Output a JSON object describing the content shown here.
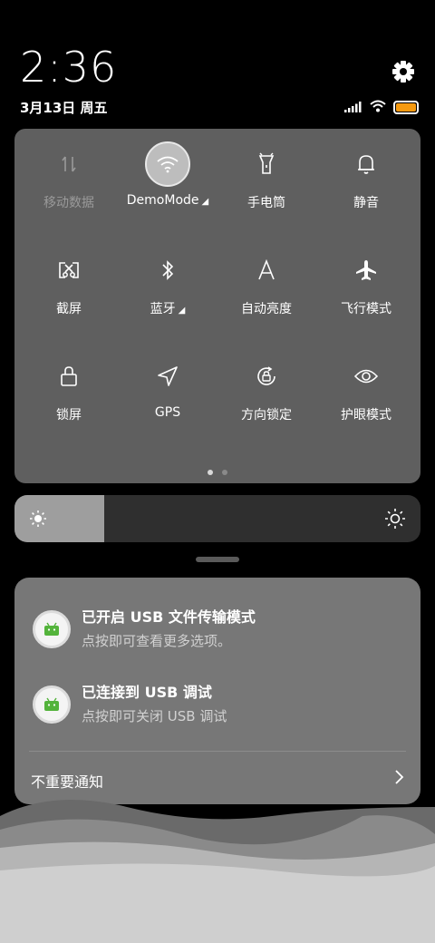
{
  "status_bar": {
    "time": "2:36",
    "date": "3月13日 周五",
    "battery_color": "#f59a10"
  },
  "quick_settings": {
    "tiles": [
      {
        "label": "移动数据",
        "icon": "mobile-data-icon",
        "state": "disabled"
      },
      {
        "label": "DemoMode",
        "icon": "wifi-icon",
        "state": "active",
        "expand": "◢"
      },
      {
        "label": "手电筒",
        "icon": "flashlight-icon",
        "state": "off"
      },
      {
        "label": "静音",
        "icon": "bell-icon",
        "state": "off"
      },
      {
        "label": "截屏",
        "icon": "screenshot-icon",
        "state": "off"
      },
      {
        "label": "蓝牙",
        "icon": "bluetooth-icon",
        "state": "off",
        "expand": "◢"
      },
      {
        "label": "自动亮度",
        "icon": "auto-brightness-icon",
        "state": "off"
      },
      {
        "label": "飞行模式",
        "icon": "airplane-icon",
        "state": "off"
      },
      {
        "label": "锁屏",
        "icon": "lock-icon",
        "state": "off"
      },
      {
        "label": "GPS",
        "icon": "location-icon",
        "state": "off"
      },
      {
        "label": "方向锁定",
        "icon": "rotation-lock-icon",
        "state": "off"
      },
      {
        "label": "护眼模式",
        "icon": "eye-icon",
        "state": "off"
      }
    ],
    "page_count": 2,
    "current_page": 1
  },
  "brightness": {
    "level": 0.22
  },
  "notifications": [
    {
      "title": "已开启 USB 文件传输模式",
      "subtitle": "点按即可查看更多选项。",
      "icon": "android-icon"
    },
    {
      "title": "已连接到 USB 调试",
      "subtitle": "点按即可关闭 USB 调试",
      "icon": "android-icon"
    }
  ],
  "unimportant_label": "不重要通知"
}
